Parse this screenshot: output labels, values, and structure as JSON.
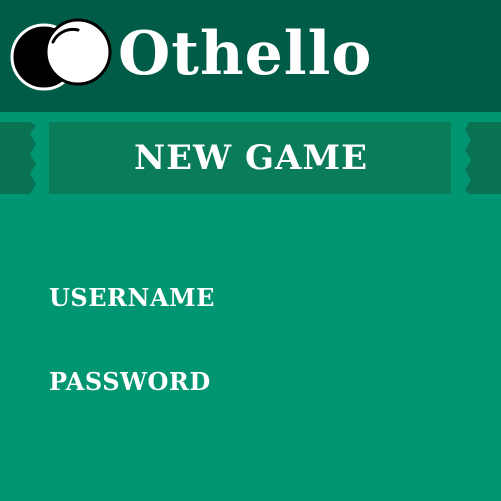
{
  "header": {
    "title": "Othello",
    "logo_icon": "othello-discs-icon"
  },
  "banner": {
    "new_game_label": "NEW GAME"
  },
  "form": {
    "username_label": "USERNAME",
    "password_label": "PASSWORD"
  },
  "colors": {
    "background": "#009672",
    "header": "#005c46",
    "banner": "#0a7c59",
    "banner_edge": "#087252",
    "text": "#ffffff"
  }
}
